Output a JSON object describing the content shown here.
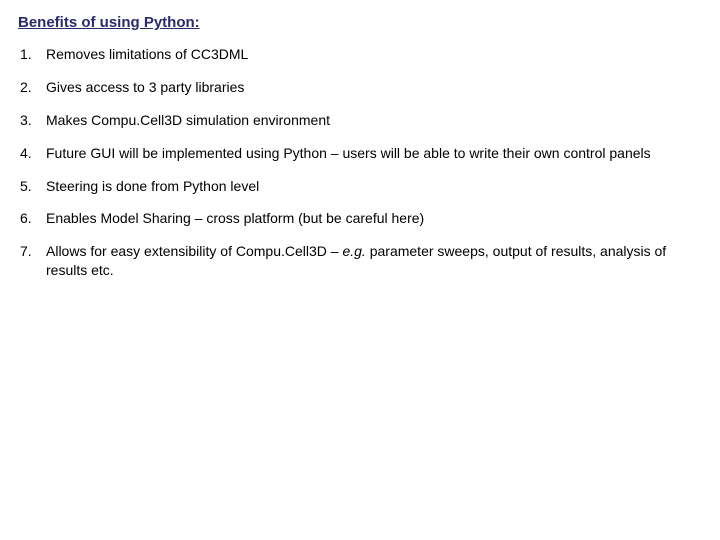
{
  "title": "Benefits of using Python:",
  "items": [
    "Removes limitations of CC3DML",
    "Gives access to 3 party libraries",
    "Makes Compu.Cell3D simulation environment",
    "Future GUI will be implemented using Python – users will be able to write their own control panels",
    "Steering is done from Python level",
    "Enables Model Sharing – cross platform (but be careful here)",
    "Allows for easy extensibility of Compu.Cell3D – e.g. parameter sweeps, output of results, analysis of results etc."
  ],
  "item7_prefix": "Allows for easy extensibility of Compu.Cell3D – ",
  "item7_italic": "e.g.",
  "item7_suffix": " parameter sweeps, output of results, analysis of results etc."
}
